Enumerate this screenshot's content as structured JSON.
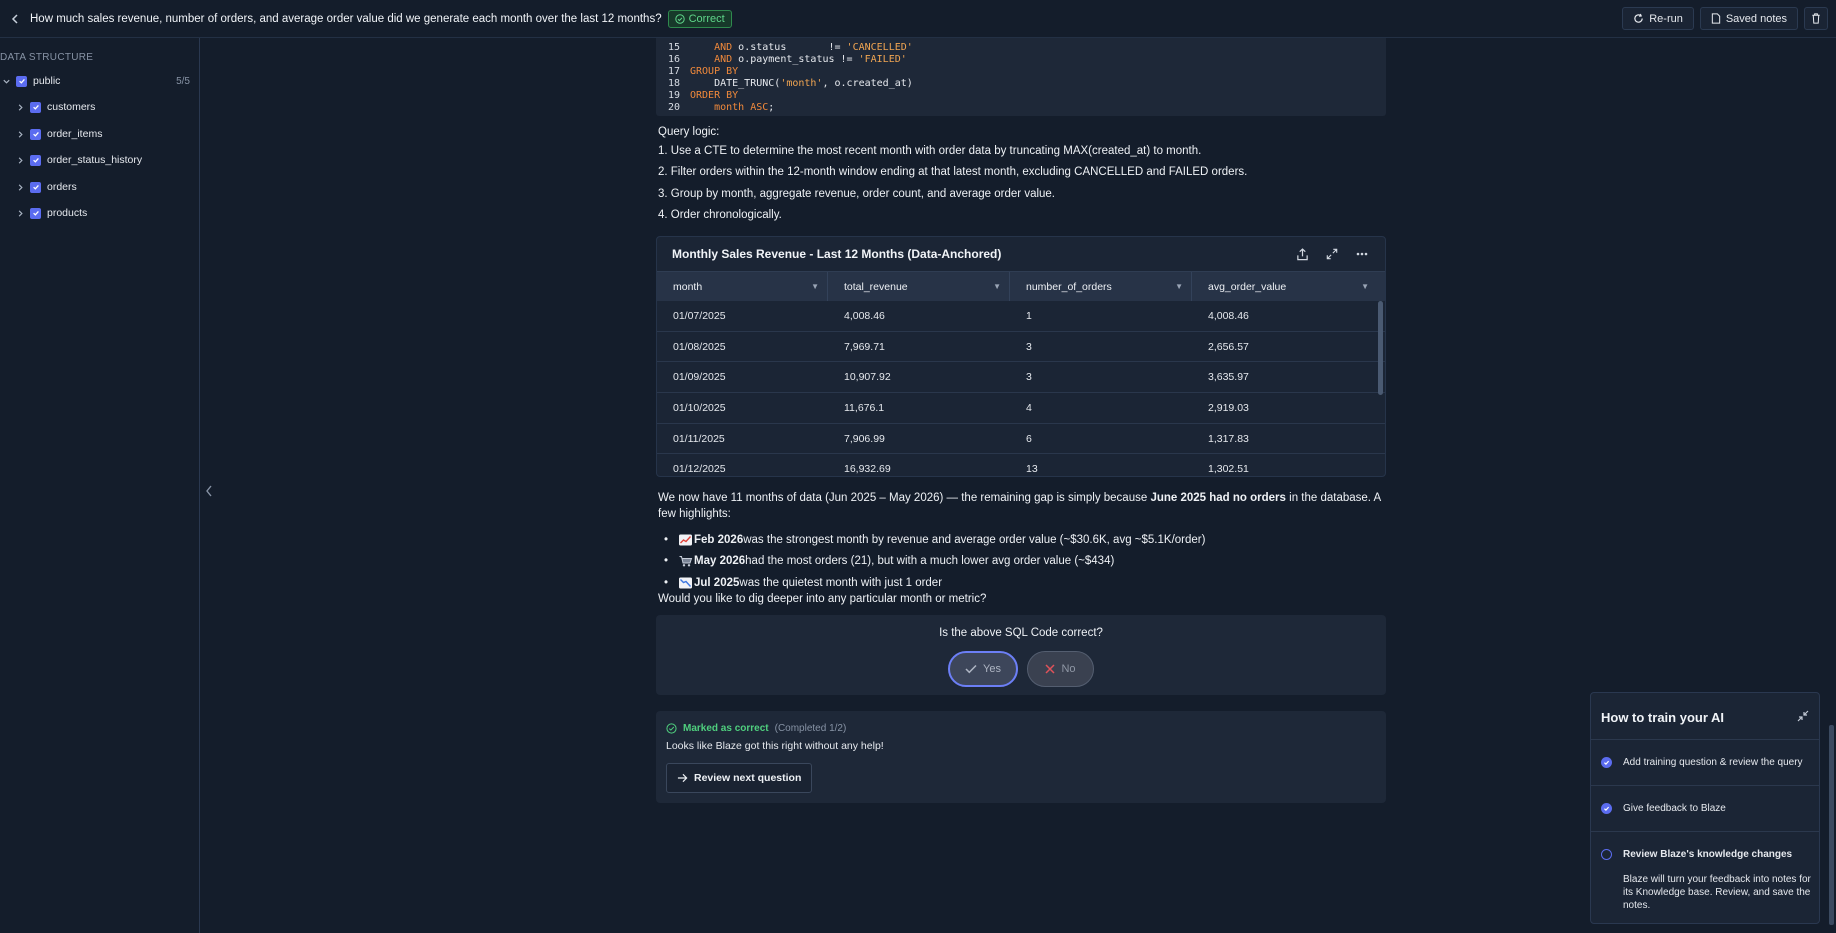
{
  "header": {
    "title": "How much sales revenue, number of orders, and average order value did we generate each month over the last 12 months?",
    "badge": "Correct",
    "rerun_label": "Re-run",
    "saved_notes_label": "Saved notes"
  },
  "sidebar": {
    "heading": "DATA STRUCTURE",
    "schema": {
      "name": "public",
      "count": "5/5"
    },
    "tables": [
      "customers",
      "order_items",
      "order_status_history",
      "orders",
      "products"
    ]
  },
  "code": {
    "lines": [
      {
        "n": "15",
        "parts": [
          {
            "t": "    ",
            "c": "plain"
          },
          {
            "t": "AND",
            "c": "kw"
          },
          {
            "t": " o.status       != ",
            "c": "plain"
          },
          {
            "t": "'CANCELLED'",
            "c": "str"
          }
        ]
      },
      {
        "n": "16",
        "parts": [
          {
            "t": "    ",
            "c": "plain"
          },
          {
            "t": "AND",
            "c": "kw"
          },
          {
            "t": " o.payment_status != ",
            "c": "plain"
          },
          {
            "t": "'FAILED'",
            "c": "str"
          }
        ]
      },
      {
        "n": "17",
        "parts": [
          {
            "t": "GROUP BY",
            "c": "kw"
          }
        ]
      },
      {
        "n": "18",
        "parts": [
          {
            "t": "    DATE_TRUNC(",
            "c": "plain"
          },
          {
            "t": "'month'",
            "c": "str"
          },
          {
            "t": ", o.created_at)",
            "c": "plain"
          }
        ]
      },
      {
        "n": "19",
        "parts": [
          {
            "t": "ORDER BY",
            "c": "kw"
          }
        ]
      },
      {
        "n": "20",
        "parts": [
          {
            "t": "    ",
            "c": "plain"
          },
          {
            "t": "month ASC",
            "c": "kw"
          },
          {
            "t": ";",
            "c": "plain"
          }
        ]
      }
    ]
  },
  "logic": {
    "title": "Query logic:",
    "steps": [
      "1. Use a CTE to determine the most recent month with order data by truncating MAX(created_at) to month.",
      "2. Filter orders within the 12-month window ending at that latest month, excluding CANCELLED and FAILED orders.",
      "3. Group by month, aggregate revenue, order count, and average order value.",
      "4. Order chronologically."
    ]
  },
  "result": {
    "title": "Monthly Sales Revenue - Last 12 Months (Data-Anchored)",
    "columns": [
      "month",
      "total_revenue",
      "number_of_orders",
      "avg_order_value"
    ],
    "rows": [
      [
        "01/07/2025",
        "4,008.46",
        "1",
        "4,008.46"
      ],
      [
        "01/08/2025",
        "7,969.71",
        "3",
        "2,656.57"
      ],
      [
        "01/09/2025",
        "10,907.92",
        "3",
        "3,635.97"
      ],
      [
        "01/10/2025",
        "11,676.1",
        "4",
        "2,919.03"
      ],
      [
        "01/11/2025",
        "7,906.99",
        "6",
        "1,317.83"
      ],
      [
        "01/12/2025",
        "16,932.69",
        "13",
        "1,302.51"
      ]
    ]
  },
  "summary": {
    "intro_a": "We now have 11 months of data (Jun 2025 – May 2026) — the remaining gap is simply because ",
    "intro_bold": "June 2025 had no orders",
    "intro_b": " in the database. A few highlights:",
    "bullets": [
      {
        "icon": "chart-up-icon",
        "bold": "Feb 2026",
        "text": " was the strongest month by revenue and average order value (~$30.6K, avg ~$5.1K/order)"
      },
      {
        "icon": "cart-icon",
        "bold": "May 2026",
        "text": " had the most orders (21), but with a much lower avg order value (~$434)"
      },
      {
        "icon": "chart-down-icon",
        "bold": "Jul 2025",
        "text": " was the quietest month with just 1 order"
      }
    ],
    "closing": "Would you like to dig deeper into any particular month or metric?"
  },
  "feedback": {
    "question": "Is the above SQL Code correct?",
    "yes": "Yes",
    "no": "No"
  },
  "status": {
    "marked": "Marked as correct",
    "completed": "(Completed 1/2)",
    "message": "Looks like Blaze got this right without any help!",
    "review_button": "Review next question"
  },
  "train": {
    "title": "How to train your AI",
    "step1": "Add training question & review the query",
    "step2": "Give feedback to Blaze",
    "step3": "Review Blaze's knowledge changes",
    "step3_desc": "Blaze will turn your feedback into notes for its Knowledge base. Review, and save the notes."
  },
  "colors": {
    "accent": "#5b6cf0",
    "success": "#4fcf7e",
    "code_keyword": "#f0893b"
  }
}
